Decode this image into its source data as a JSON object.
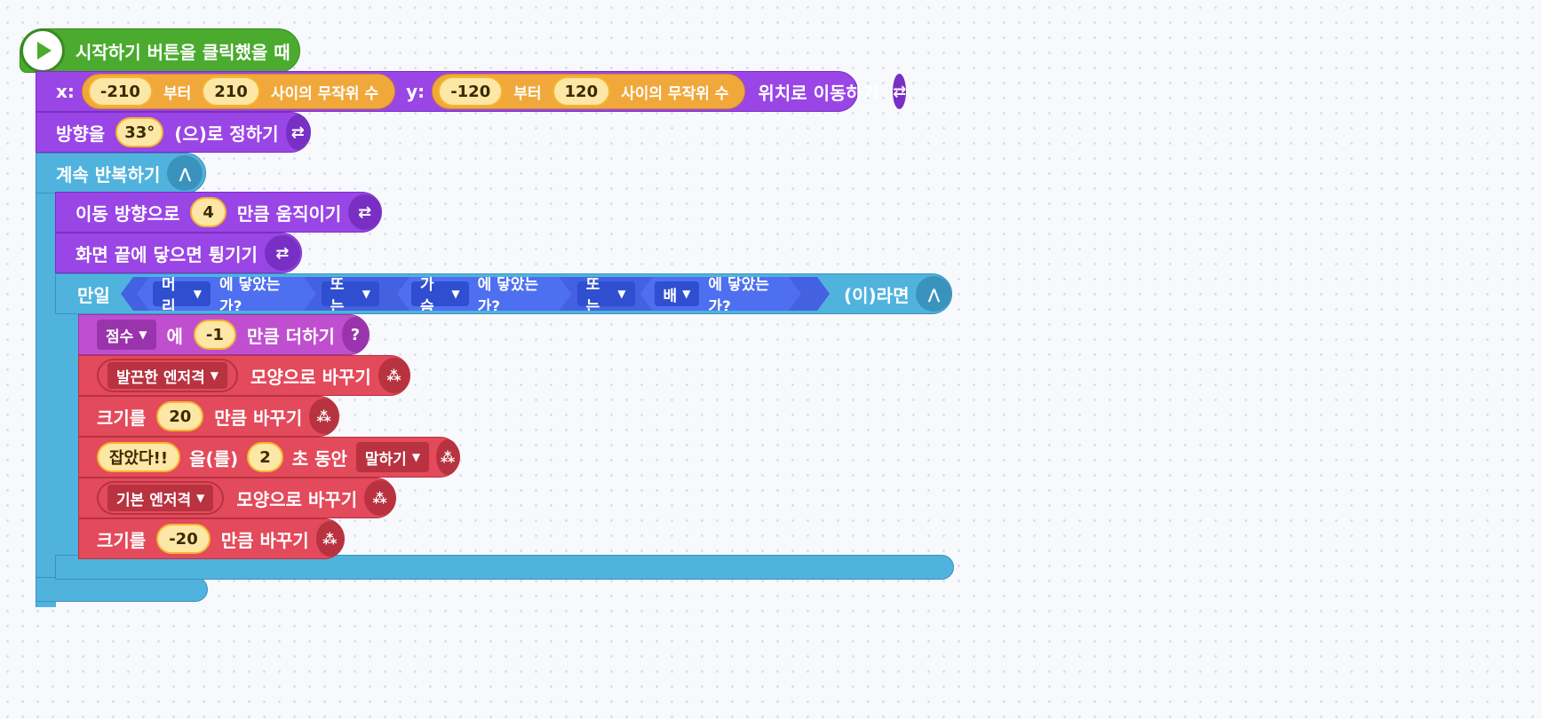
{
  "event": {
    "label": "시작하기 버튼을 클릭했을 때"
  },
  "move_random": {
    "x_label": "x:",
    "x_min": "-210",
    "bu_ter1": "부터",
    "x_max": "210",
    "between1": "사이의 무작위 수",
    "y_label": "y:",
    "y_min": "-120",
    "bu_ter2": "부터",
    "y_max": "120",
    "between2": "사이의 무작위 수",
    "suffix": "위치로 이동하기"
  },
  "set_direction": {
    "prefix": "방향을",
    "value": "33°",
    "suffix": "(으)로 정하기"
  },
  "forever": {
    "label": "계속 반복하기"
  },
  "move_dir": {
    "prefix": "이동 방향으로",
    "value": "4",
    "suffix": "만큼 움직이기"
  },
  "bounce": {
    "label": "화면 끝에 닿으면 튕기기"
  },
  "if_block": {
    "if_label": "만일",
    "then_label": "(이)라면",
    "or1": "또는",
    "or2": "또는",
    "touch1_target": "머리",
    "touch1_suffix": "에 닿았는가?",
    "touch2_target": "가슴",
    "touch2_suffix": "에 닿았는가?",
    "touch3_target": "배",
    "touch3_suffix": "에 닿았는가?"
  },
  "add_var": {
    "var": "점수",
    "mid": "에",
    "value": "-1",
    "suffix": "만큼 더하기",
    "icon_glyph": "?"
  },
  "shape1": {
    "shape": "발끈한 엔저격",
    "suffix": "모양으로 바꾸기"
  },
  "size1": {
    "prefix": "크기를",
    "value": "20",
    "suffix": "만큼 바꾸기"
  },
  "say": {
    "text": "잡았다!!",
    "mid": "을(를)",
    "value": "2",
    "unit": "초 동안",
    "mode": "말하기"
  },
  "shape2": {
    "shape": "기본 엔저격",
    "suffix": "모양으로 바꾸기"
  },
  "size2": {
    "prefix": "크기를",
    "value": "-20",
    "suffix": "만큼 바꾸기"
  },
  "colors": {
    "event": "#4aab2e",
    "motion": "#9a45e6",
    "flow": "#4fb3de",
    "looks": "#e34a5b",
    "variable": "#c04fd0",
    "judge": "#4d6ff0"
  }
}
